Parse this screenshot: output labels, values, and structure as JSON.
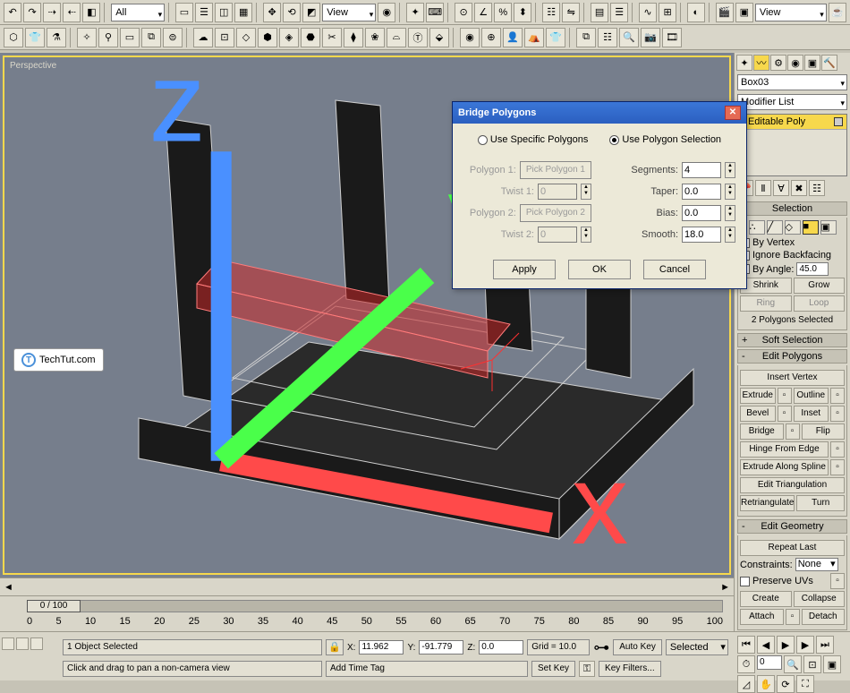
{
  "toolbar": {
    "dropdown1": "All",
    "dropdown2": "View",
    "dropdown3": "View"
  },
  "viewport": {
    "label": "Perspective",
    "watermark_text": "TechTut.com",
    "watermark_icon_letter": "T"
  },
  "dialog": {
    "title": "Bridge Polygons",
    "radio1_label": "Use Specific Polygons",
    "radio2_label": "Use Polygon Selection",
    "polygon1_label": "Polygon 1:",
    "pick1_btn": "Pick Polygon 1",
    "twist1_label": "Twist 1:",
    "twist1_value": "0",
    "polygon2_label": "Polygon 2:",
    "pick2_btn": "Pick Polygon 2",
    "twist2_label": "Twist 2:",
    "twist2_value": "0",
    "segments_label": "Segments:",
    "segments_value": "4",
    "taper_label": "Taper:",
    "taper_value": "0.0",
    "bias_label": "Bias:",
    "bias_value": "0.0",
    "smooth_label": "Smooth:",
    "smooth_value": "18.0",
    "apply_btn": "Apply",
    "ok_btn": "OK",
    "cancel_btn": "Cancel"
  },
  "panel": {
    "object_name": "Box03",
    "modifier_dd": "Modifier List",
    "stack_item": "Editable Poly",
    "selection_hdr": "Selection",
    "by_vertex": "By Vertex",
    "ignore_backfacing": "Ignore Backfacing",
    "by_angle": "By Angle:",
    "by_angle_value": "45.0",
    "shrink_btn": "Shrink",
    "grow_btn": "Grow",
    "ring_btn": "Ring",
    "loop_btn": "Loop",
    "sel_info": "2 Polygons Selected",
    "soft_sel_hdr": "Soft Selection",
    "edit_poly_hdr": "Edit Polygons",
    "insert_vertex_btn": "Insert Vertex",
    "extrude_btn": "Extrude",
    "outline_btn": "Outline",
    "bevel_btn": "Bevel",
    "inset_btn": "Inset",
    "bridge_btn": "Bridge",
    "flip_btn": "Flip",
    "hinge_btn": "Hinge From Edge",
    "extrude_spline_btn": "Extrude Along Spline",
    "edit_tri_btn": "Edit Triangulation",
    "retri_btn": "Retriangulate",
    "turn_btn": "Turn",
    "edit_geom_hdr": "Edit Geometry",
    "repeat_last_btn": "Repeat Last",
    "constraints_label": "Constraints:",
    "constraints_value": "None",
    "preserve_uvs": "Preserve UVs",
    "create_btn": "Create",
    "collapse_btn": "Collapse",
    "attach_btn": "Attach",
    "detach_btn": "Detach"
  },
  "timeline": {
    "slider_text": "0 / 100",
    "ticks": [
      "0",
      "5",
      "10",
      "15",
      "20",
      "25",
      "30",
      "35",
      "40",
      "45",
      "50",
      "55",
      "60",
      "65",
      "70",
      "75",
      "80",
      "85",
      "90",
      "95",
      "100"
    ]
  },
  "status": {
    "selected_text": "1 Object Selected",
    "hint_text": "Click and drag to pan a non-camera view",
    "x_label": "X:",
    "x_value": "11.962",
    "y_label": "Y:",
    "y_value": "-91.779",
    "z_label": "Z:",
    "z_value": "0.0",
    "grid_text": "Grid = 10.0",
    "add_time_tag": "Add Time Tag",
    "auto_key": "Auto Key",
    "set_key": "Set Key",
    "selected_dd": "Selected",
    "key_filters": "Key Filters...",
    "frame_value": "0"
  }
}
